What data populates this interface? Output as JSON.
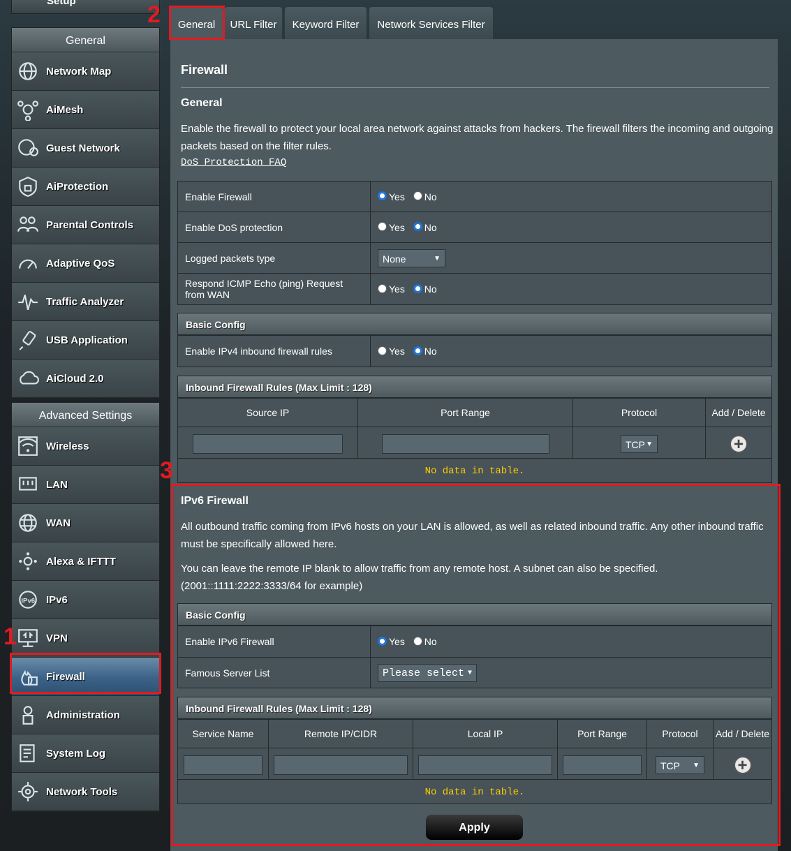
{
  "sidebar": {
    "setup_label": "Setup",
    "general": {
      "title": "General",
      "items": [
        {
          "label": "Network Map",
          "icon": "globe-icon"
        },
        {
          "label": "AiMesh",
          "icon": "aimesh-icon"
        },
        {
          "label": "Guest Network",
          "icon": "guest-network-icon"
        },
        {
          "label": "AiProtection",
          "icon": "shield-lock-icon"
        },
        {
          "label": "Parental Controls",
          "icon": "family-icon"
        },
        {
          "label": "Adaptive QoS",
          "icon": "gauge-icon"
        },
        {
          "label": "Traffic Analyzer",
          "icon": "pulse-icon"
        },
        {
          "label": "USB Application",
          "icon": "usb-icon"
        },
        {
          "label": "AiCloud 2.0",
          "icon": "cloud-icon"
        }
      ]
    },
    "advanced": {
      "title": "Advanced Settings",
      "items": [
        {
          "label": "Wireless",
          "icon": "wifi-icon"
        },
        {
          "label": "LAN",
          "icon": "lan-icon"
        },
        {
          "label": "WAN",
          "icon": "wan-globe-icon"
        },
        {
          "label": "Alexa & IFTTT",
          "icon": "alexa-icon"
        },
        {
          "label": "IPv6",
          "icon": "ipv6-icon"
        },
        {
          "label": "VPN",
          "icon": "vpn-icon"
        },
        {
          "label": "Firewall",
          "icon": "firewall-icon",
          "active": true
        },
        {
          "label": "Administration",
          "icon": "admin-icon"
        },
        {
          "label": "System Log",
          "icon": "log-icon"
        },
        {
          "label": "Network Tools",
          "icon": "tools-icon"
        }
      ]
    }
  },
  "tabs": [
    "General",
    "URL Filter",
    "Keyword Filter",
    "Network Services Filter"
  ],
  "markers": [
    "1",
    "2",
    "3"
  ],
  "page": {
    "title": "Firewall",
    "general_heading": "General",
    "description": "Enable the firewall to protect your local area network against attacks from hackers. The firewall filters the incoming and outgoing packets based on the filter rules.",
    "faq_link": "DoS Protection FAQ"
  },
  "settings": {
    "enable_firewall": {
      "label": "Enable Firewall",
      "yes": "Yes",
      "no": "No",
      "value": "Yes"
    },
    "enable_dos": {
      "label": "Enable DoS protection",
      "yes": "Yes",
      "no": "No",
      "value": "No"
    },
    "logged_packets": {
      "label": "Logged packets type",
      "value": "None"
    },
    "icmp_echo": {
      "label": "Respond ICMP Echo (ping) Request from WAN",
      "yes": "Yes",
      "no": "No",
      "value": "No"
    }
  },
  "basic_config": {
    "heading": "Basic Config",
    "ipv4_inbound": {
      "label": "Enable IPv4 inbound firewall rules",
      "yes": "Yes",
      "no": "No",
      "value": "No"
    }
  },
  "inbound_v4": {
    "heading": "Inbound Firewall Rules (Max Limit : 128)",
    "columns": [
      "Source IP",
      "Port Range",
      "Protocol",
      "Add / Delete"
    ],
    "protocol": "TCP",
    "empty": "No data in table."
  },
  "ipv6": {
    "title": "IPv6 Firewall",
    "para1": "All outbound traffic coming from IPv6 hosts on your LAN is allowed, as well as related inbound traffic. Any other inbound traffic must be specifically allowed here.",
    "para2": "You can leave the remote IP blank to allow traffic from any remote host. A subnet can also be specified. (2001::1111:2222:3333/64 for example)",
    "basic_heading": "Basic Config",
    "enable": {
      "label": "Enable IPv6 Firewall",
      "yes": "Yes",
      "no": "No",
      "value": "Yes"
    },
    "famous": {
      "label": "Famous Server List",
      "value": "Please select"
    },
    "rules_heading": "Inbound Firewall Rules (Max Limit : 128)",
    "columns": [
      "Service Name",
      "Remote IP/CIDR",
      "Local IP",
      "Port Range",
      "Protocol",
      "Add / Delete"
    ],
    "protocol": "TCP",
    "empty": "No data in table."
  },
  "apply_label": "Apply",
  "colors": {
    "accent": "#e01b22",
    "nodata": "#ffcc00",
    "active": "#3a6288"
  }
}
